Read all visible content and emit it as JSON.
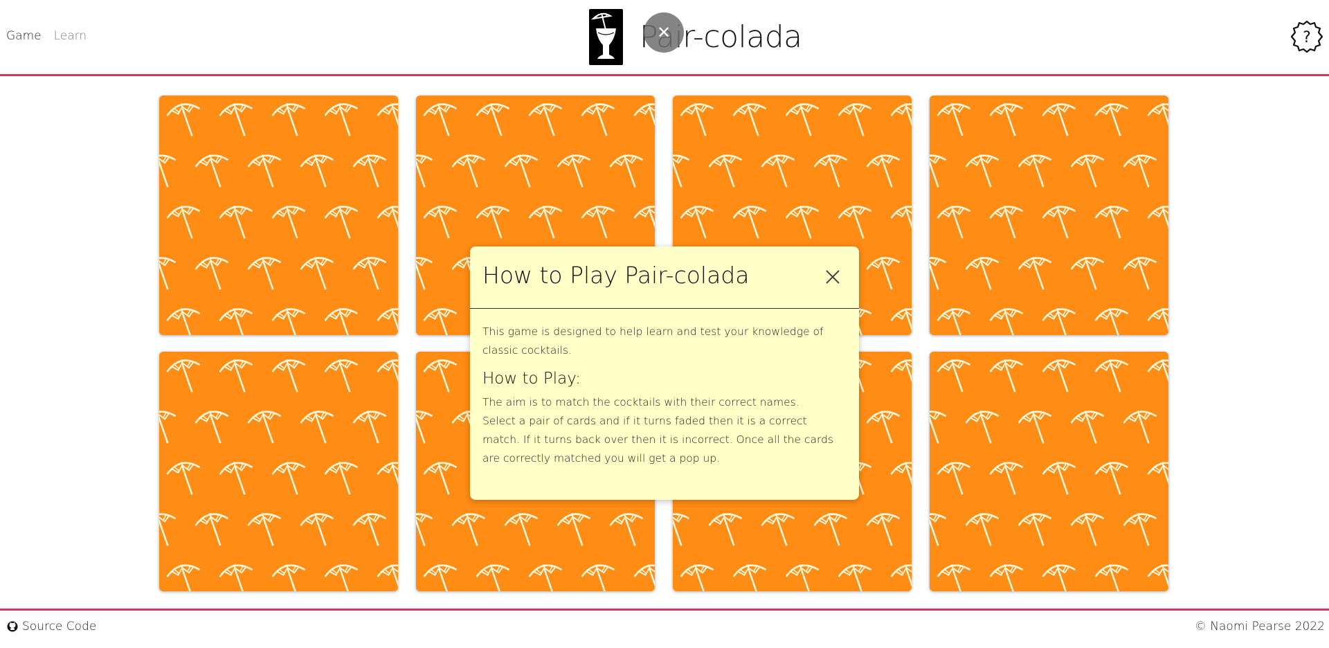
{
  "header": {
    "nav": [
      {
        "label": "Game"
      },
      {
        "label": "Learn"
      }
    ],
    "brand_title": "Pair-colada",
    "help_icon": "question-badge-icon",
    "logo_icon": "cocktail-glass-icon"
  },
  "cards": {
    "count": 8,
    "back_color": "#ff8c14",
    "pattern_icon": "cocktail-umbrella-icon"
  },
  "modal": {
    "title": "How to Play Pair-colada",
    "intro": "This game is designed to help learn and test your knowledge of classic cocktails.",
    "subheading": "How to Play:",
    "lines": [
      "The aim is to match the cocktails with their correct names.",
      "Select a pair of cards and if it turns faded then it is a correct match. If it turns back over then it is incorrect. Once all the cards are correctly matched you will get a pop up."
    ],
    "background": "#ffffc8"
  },
  "footer": {
    "source_label": "Source Code",
    "copyright": "© Naomi Pearse 2022"
  },
  "colors": {
    "accent": "#e0325f",
    "card_orange": "#ff8c14"
  }
}
